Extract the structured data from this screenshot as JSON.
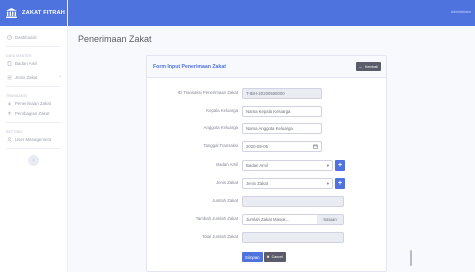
{
  "brand": {
    "name": "ZAKAT FITRAH"
  },
  "topbar": {
    "user": "Administrator"
  },
  "sidebar": {
    "dashboard": "Dashboard",
    "heading_master": "DATA MASTER",
    "badan_amil": "Badan Amil",
    "jenis_zakat": "Jenis Zakat",
    "heading_transaksi": "TRANSAKSI",
    "penerimaan": "Penerimaan Zakat",
    "pembagian": "Pembagian Zakat",
    "heading_setting": "SETTING",
    "user_mgmt": "User Management"
  },
  "page": {
    "title": "Penerimaan Zakat"
  },
  "card": {
    "title": "Form Input Penerimaan Zakat",
    "back_label": "Kembali"
  },
  "form": {
    "id_label": "ID Transaksi Penerimaan Zakat",
    "id_value": "T-IBH-20200508000",
    "kepala_label": "Kepala Keluarga",
    "kepala_placeholder": "Nama Kepala Keluarga",
    "anggota_label": "Anggota Keluarga",
    "anggota_placeholder": "Nama Anggota Keluarga",
    "tanggal_label": "Tanggal Transaksi",
    "tanggal_value": "2020-09-05",
    "badan_label": "Badan Amil",
    "badan_value": "Badan Amil",
    "jenis_label": "Jenis Zakat",
    "jenis_value": "Jenis Zakat",
    "jumlah_label": "Jumlah Zakat",
    "tambah_label": "Tambah Jumlah Zakat",
    "tambah_placeholder": "Jumlah Zakat Masuk...",
    "satuan": "Satuan",
    "total_label": "Total Jumlah Zakat",
    "save_label": "Simpan",
    "cancel_label": "Cancel"
  },
  "colors": {
    "primary": "#4e73df",
    "secondary": "#5a5c69"
  }
}
